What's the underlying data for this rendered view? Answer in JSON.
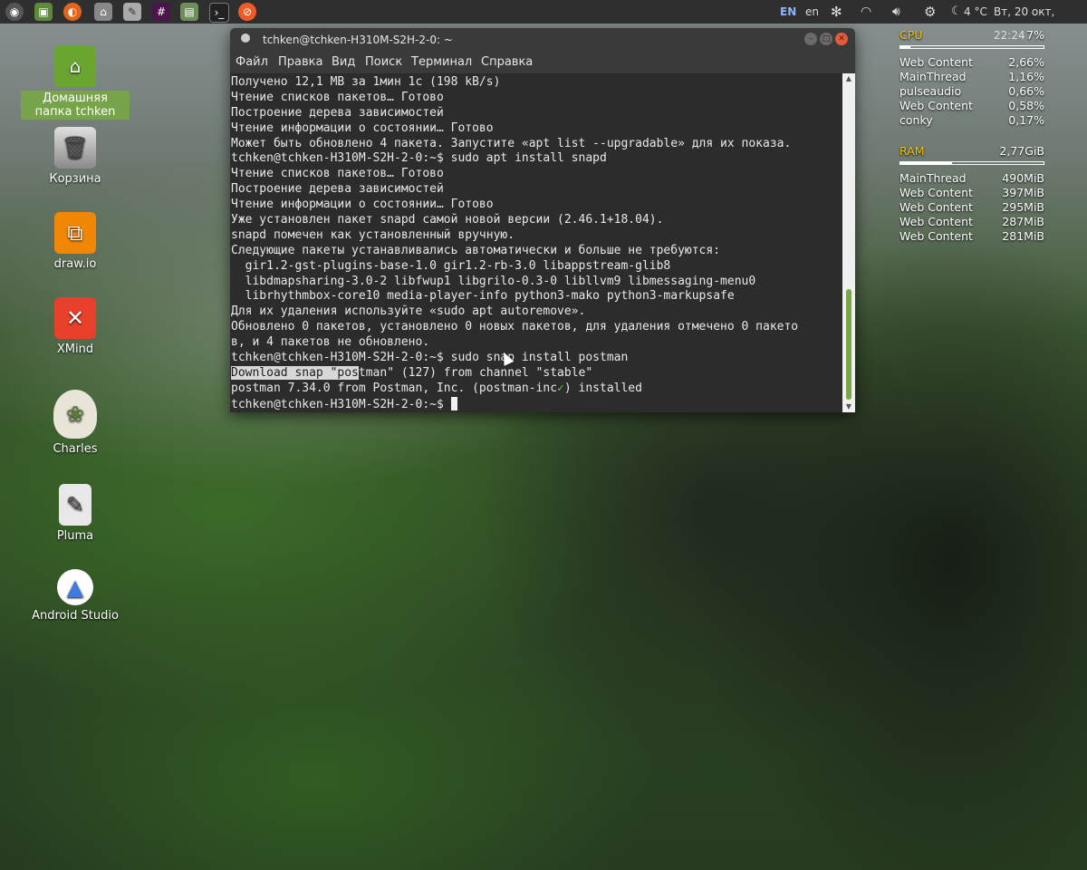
{
  "panel": {
    "launchers": [
      "menu-icon",
      "image-viewer-icon",
      "firefox-icon",
      "teapot-icon",
      "text-editor-icon",
      "slack-icon",
      "disk-icon",
      "terminal-icon",
      "compass-icon"
    ],
    "lang_primary": "EN",
    "lang_secondary": "en",
    "weather": "4 °C",
    "datetime": "Вт, 20 окт, 22:24"
  },
  "desktop": {
    "icons": [
      {
        "label": "Домашняя папка tchken",
        "icon": "home-folder-icon",
        "color": "#6aa532"
      },
      {
        "label": "Корзина",
        "icon": "trash-icon",
        "color": "#9a9a9a"
      },
      {
        "label": "draw.io",
        "icon": "drawio-icon",
        "color": "#f08705"
      },
      {
        "label": "XMind",
        "icon": "xmind-icon",
        "color": "#e8402a"
      },
      {
        "label": "Charles",
        "icon": "charles-jug-icon",
        "color": "#dcd7c8"
      },
      {
        "label": "Pluma",
        "icon": "pluma-icon",
        "color": "#cfcfcf"
      },
      {
        "label": "Android Studio",
        "icon": "android-studio-icon",
        "color": "#3d7be0"
      }
    ]
  },
  "terminal": {
    "title": "tchken@tchken-H310M-S2H-2-0: ~",
    "menu": [
      "Файл",
      "Правка",
      "Вид",
      "Поиск",
      "Терминал",
      "Справка"
    ],
    "lines": [
      "Получено 12,1 MB за 1мин 1с (198 kB/s)",
      "Чтение списков пакетов… Готово",
      "Построение дерева зависимостей",
      "Чтение информации о состоянии… Готово",
      "Может быть обновлено 4 пакета. Запустите «apt list --upgradable» для их показа.",
      "tchken@tchken-H310M-S2H-2-0:~$ sudo apt install snapd",
      "Чтение списков пакетов… Готово",
      "Построение дерева зависимостей",
      "Чтение информации о состоянии… Готово",
      "Уже установлен пакет snapd самой новой версии (2.46.1+18.04).",
      "snapd помечен как установленный вручную.",
      "Следующие пакеты устанавливались автоматически и больше не требуются:",
      "  gir1.2-gst-plugins-base-1.0 gir1.2-rb-3.0 libappstream-glib8",
      "  libdmapsharing-3.0-2 libfwup1 libgrilo-0.3-0 libllvm9 libmessaging-menu0",
      "  librhythmbox-core10 media-player-info python3-mako python3-markupsafe",
      "Для их удаления используйте «sudo apt autoremove».",
      "Обновлено 0 пакетов, установлено 0 новых пакетов, для удаления отмечено 0 пакето",
      "в, и 4 пакетов не обновлено.",
      "tchken@tchken-H310M-S2H-2-0:~$ sudo snap install postman"
    ],
    "download_highlight": "Download snap \"pos",
    "download_rest": "tman\" (127) from channel \"stable\"",
    "installed_prefix": "postman 7.34.0 from Postman, Inc. (postman-inc",
    "installed_check": "✓",
    "installed_suffix": ") installed",
    "prompt": "tchken@tchken-H310M-S2H-2-0:~$ "
  },
  "conky": {
    "cpu_label": "CPU",
    "cpu_value": "7%",
    "cpu_fraction": 0.07,
    "cpu_procs": [
      {
        "name": "Web Content",
        "value": "2,66%"
      },
      {
        "name": "MainThread",
        "value": "1,16%"
      },
      {
        "name": "pulseaudio",
        "value": "0,66%"
      },
      {
        "name": "Web Content",
        "value": "0,58%"
      },
      {
        "name": "conky",
        "value": "0,17%"
      }
    ],
    "ram_label": "RAM",
    "ram_value": "2,77GiB",
    "ram_fraction": 0.36,
    "ram_procs": [
      {
        "name": "MainThread",
        "value": "490MiB"
      },
      {
        "name": "Web Content",
        "value": "397MiB"
      },
      {
        "name": "Web Content",
        "value": "295MiB"
      },
      {
        "name": "Web Content",
        "value": "287MiB"
      },
      {
        "name": "Web Content",
        "value": "281MiB"
      }
    ]
  }
}
